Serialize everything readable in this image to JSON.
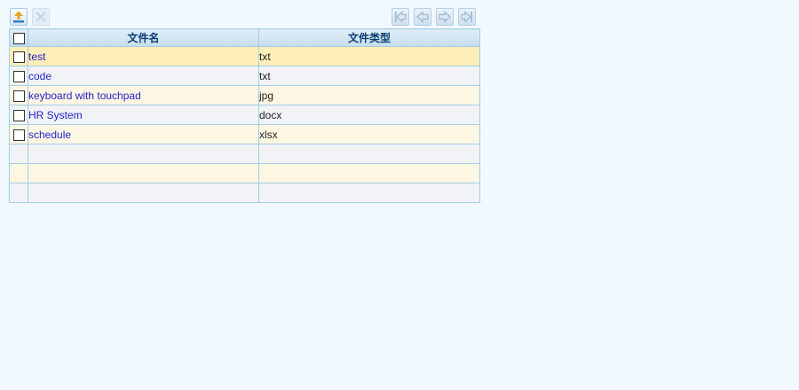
{
  "toolbar": {
    "upload_icon": "upload-icon",
    "delete_icon": "delete-icon",
    "nav": [
      "first-page-icon",
      "prev-page-icon",
      "next-page-icon",
      "last-page-icon"
    ]
  },
  "table": {
    "columns": [
      "文件名",
      "文件类型"
    ],
    "rows": [
      {
        "name": "test",
        "type": "txt",
        "selected": true
      },
      {
        "name": "code",
        "type": "txt"
      },
      {
        "name": "keyboard with touchpad",
        "type": "jpg"
      },
      {
        "name": "HR System",
        "type": "docx"
      },
      {
        "name": "schedule",
        "type": "xlsx"
      }
    ],
    "empty_rows": 3
  },
  "colors": {
    "background": "#f1f8fe",
    "link": "#2323c8",
    "header_text": "#0b3d72",
    "selected_row": "#ffeeb8",
    "border": "#a5cde6"
  }
}
